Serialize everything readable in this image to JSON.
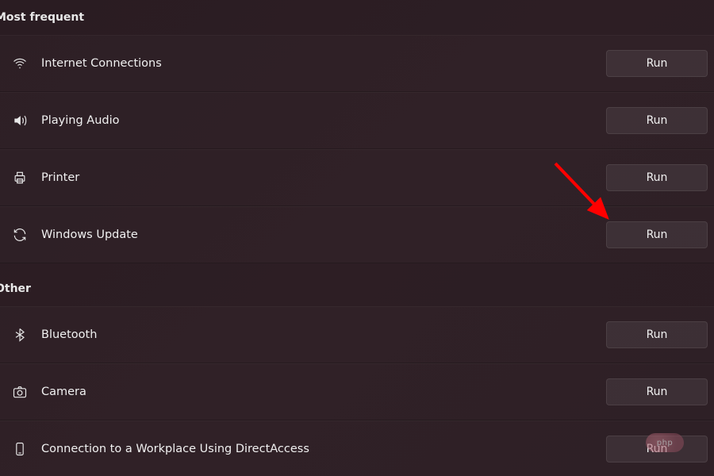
{
  "sections": [
    {
      "title": "Most frequent",
      "items": [
        {
          "icon": "wifi",
          "label": "Internet Connections",
          "button": "Run"
        },
        {
          "icon": "audio",
          "label": "Playing Audio",
          "button": "Run"
        },
        {
          "icon": "printer",
          "label": "Printer",
          "button": "Run"
        },
        {
          "icon": "update",
          "label": "Windows Update",
          "button": "Run"
        }
      ]
    },
    {
      "title": "Other",
      "items": [
        {
          "icon": "bluetooth",
          "label": "Bluetooth",
          "button": "Run"
        },
        {
          "icon": "camera",
          "label": "Camera",
          "button": "Run"
        },
        {
          "icon": "device",
          "label": "Connection to a Workplace Using DirectAccess",
          "button": "Run"
        }
      ]
    }
  ],
  "watermark": "php",
  "annotation": {
    "arrow_color": "#ff0000",
    "target": "windows-update-run-button"
  }
}
